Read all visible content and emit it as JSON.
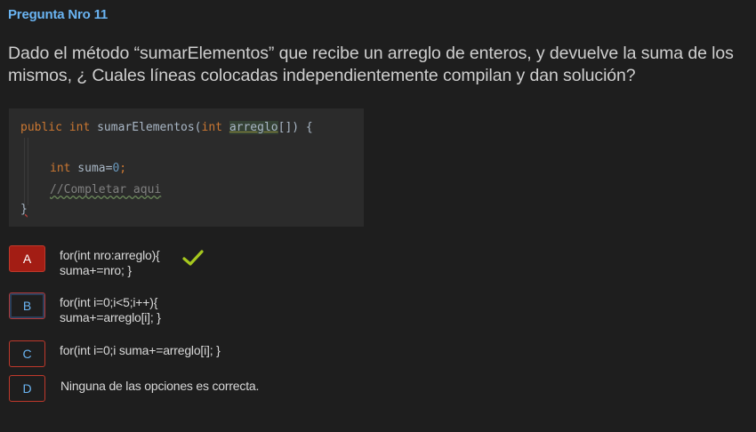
{
  "question": {
    "number_label": "Pregunta Nro 11",
    "text": "Dado el método “sumarElementos” que recibe un arreglo de enteros, y devuelve la suma de los mismos, ¿ Cuales líneas colocadas independientemente compilan y dan solución?"
  },
  "code": {
    "line1": {
      "public": "public",
      "int": "int",
      "name": " sumarElementos(",
      "int2": "int",
      "space": " ",
      "param": "arreglo",
      "rest": "[]) {"
    },
    "line2": {
      "int": "int",
      "rest_a": " suma=",
      "zero": "0",
      "semi": ";"
    },
    "line3": {
      "comment": "//Completar aqui"
    },
    "line4": {
      "brace": "}"
    }
  },
  "options": [
    {
      "letter": "A",
      "text": "for(int nro:arreglo){\nsuma+=nro; }",
      "state": "selected-correct"
    },
    {
      "letter": "B",
      "text": "for(int i=0;i<5;i++){\nsuma+=arreglo[i]; }",
      "state": "focused"
    },
    {
      "letter": "C",
      "text": "for(int i=0;i suma+=arreglo[i]; }",
      "state": "default"
    },
    {
      "letter": "D",
      "text": "Ninguna de las opciones es correcta.",
      "state": "default"
    }
  ],
  "colors": {
    "background": "#1e1e1e",
    "accent_blue": "#6ab4f2",
    "selected_red": "#a31d14",
    "check_green": "#a6c81e"
  },
  "icons": {
    "correct": "checkmark-icon"
  }
}
